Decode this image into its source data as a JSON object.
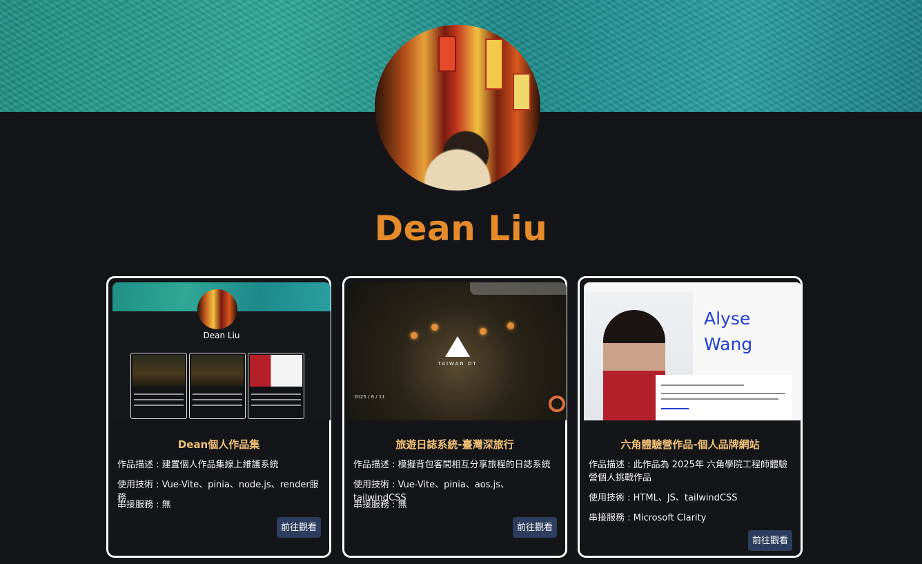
{
  "header": {
    "name": "Dean Liu"
  },
  "colors": {
    "accent_name": "#e58b2b",
    "card_title": "#f2c276",
    "button_bg": "#2c3d5e",
    "background": "#141518"
  },
  "cards": [
    {
      "title": "Dean個人作品集",
      "description": "作品描述 : 建置個人作品集線上維護系統",
      "tech": "使用技術 : Vue-Vite、pinia、node.js、render服務",
      "service": "串接服務 : 無",
      "button": "前往觀看",
      "thumb_name": "Dean Liu"
    },
    {
      "title": "旅遊日誌系統-臺灣深旅行",
      "description": "作品描述 : 模擬背包客間相互分享旅程的日誌系統",
      "tech": "使用技術 : Vue-Vite、pinia、aos.js、tailwindCSS",
      "service": "串接服務 : 無",
      "button": "前往觀看",
      "thumb_logo": "TAIWAN DT",
      "thumb_date": "2025 / 6 / 11"
    },
    {
      "title": "六角體驗營作品-個人品牌網站",
      "description": "作品描述 : 此作品為 2025年 六角學院工程師體驗營個人挑戰作品",
      "tech": "使用技術 : HTML、JS、tailwindCSS",
      "service": "串接服務 : Microsoft Clarity",
      "button": "前往觀看",
      "thumb_heading_1": "Alyse",
      "thumb_heading_2": "Wang"
    }
  ]
}
